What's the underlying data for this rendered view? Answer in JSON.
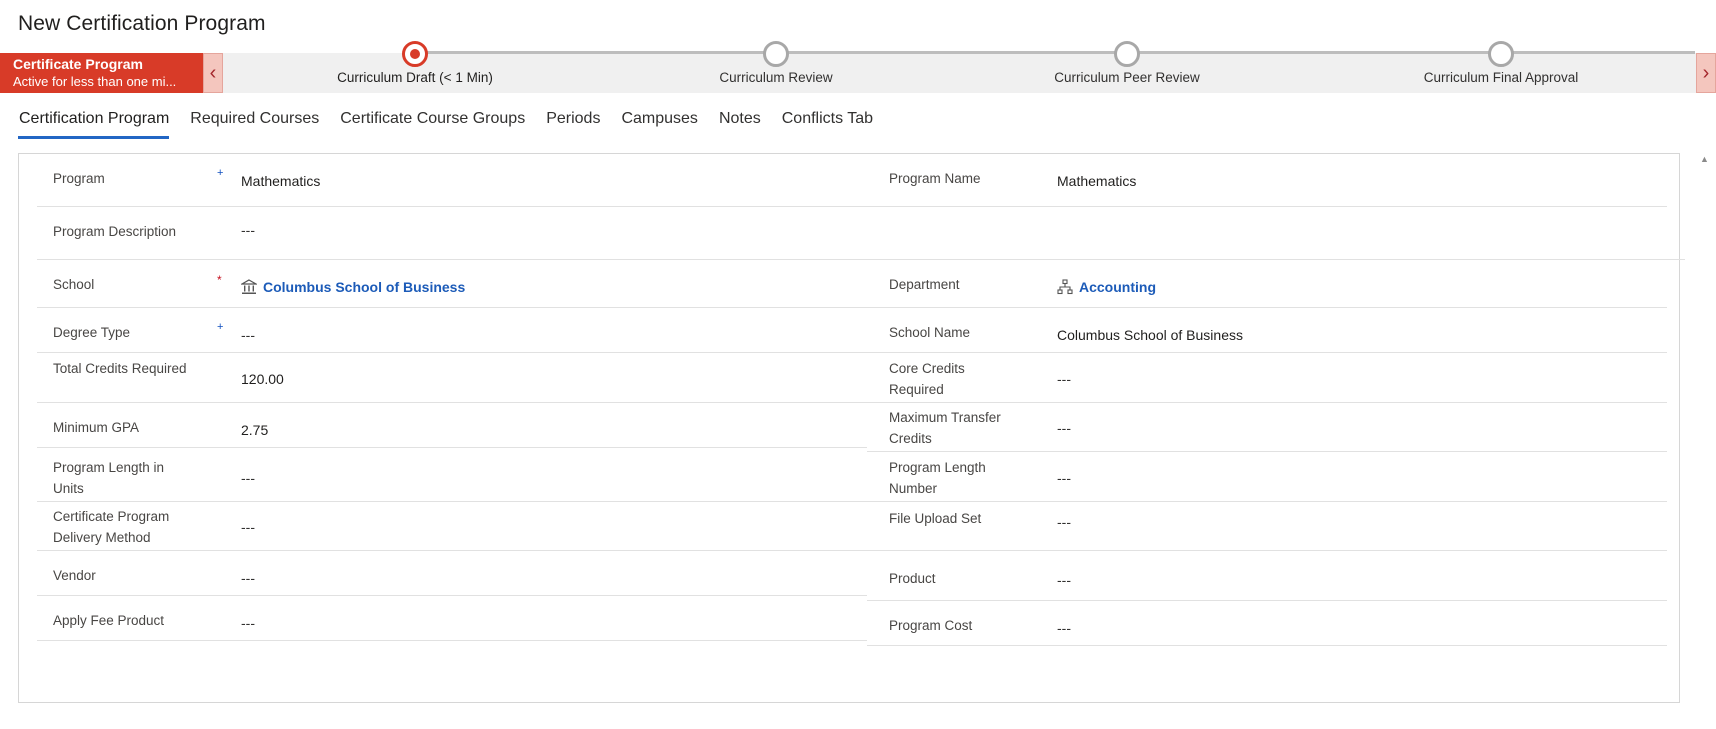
{
  "page": {
    "title": "New Certification Program"
  },
  "process": {
    "active": {
      "title": "Certificate Program",
      "subtitle": "Active for less than one mi..."
    },
    "stages": [
      {
        "label": "Curriculum Draft  (< 1 Min)",
        "active": true
      },
      {
        "label": "Curriculum Review",
        "active": false
      },
      {
        "label": "Curriculum Peer Review",
        "active": false
      },
      {
        "label": "Curriculum Final Approval",
        "active": false
      }
    ],
    "prev_icon": "chevron-left-icon",
    "next_icon": "chevron-right-icon"
  },
  "tabs": [
    {
      "label": "Certification Program",
      "active": true
    },
    {
      "label": "Required Courses"
    },
    {
      "label": "Certificate Course Groups"
    },
    {
      "label": "Periods"
    },
    {
      "label": "Campuses"
    },
    {
      "label": "Notes"
    },
    {
      "label": "Conflicts Tab"
    }
  ],
  "form": {
    "left": [
      {
        "label": "Program",
        "required": "recommended",
        "value": "Mathematics"
      },
      {
        "label": "Program Description",
        "value": "---"
      },
      {
        "label": "School",
        "required": "required",
        "value": "Columbus School of Business",
        "icon": "school-building-icon"
      },
      {
        "label": "Degree Type",
        "required": "recommended",
        "value": "---"
      },
      {
        "label": "Total Credits Required",
        "value": "120.00"
      },
      {
        "label": "Minimum GPA",
        "value": "2.75"
      },
      {
        "label": "Program Length in Units",
        "value": "---"
      },
      {
        "label": "Certificate Program Delivery Method",
        "value": "---"
      },
      {
        "label": "Vendor",
        "value": "---"
      },
      {
        "label": "Apply Fee Product",
        "value": "---"
      }
    ],
    "right": [
      {
        "label": "Program Name",
        "value": "Mathematics"
      },
      {
        "label": "Department",
        "value": "Accounting",
        "icon": "org-chart-icon"
      },
      {
        "label": "School Name",
        "value": "Columbus School of Business"
      },
      {
        "label": "Core Credits Required",
        "value": "---"
      },
      {
        "label": "Maximum Transfer Credits",
        "value": "---"
      },
      {
        "label": "Program Length Number",
        "value": "---"
      },
      {
        "label": "File Upload Set",
        "value": "---"
      },
      {
        "label": "Product",
        "value": "---"
      },
      {
        "label": "Program Cost",
        "value": "---"
      }
    ]
  },
  "marks": {
    "recommended": "+",
    "required": "*"
  }
}
